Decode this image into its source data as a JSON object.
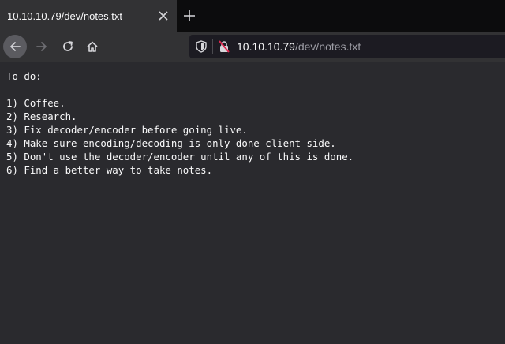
{
  "tab": {
    "title": "10.10.10.79/dev/notes.txt",
    "close_icon": "close-icon",
    "new_tab_icon": "plus-icon"
  },
  "nav": {
    "back_icon": "arrow-left-icon",
    "forward_icon": "arrow-right-icon",
    "reload_icon": "reload-icon",
    "home_icon": "home-icon"
  },
  "url": {
    "host": "10.10.10.79",
    "path": "/dev/notes.txt",
    "shield_icon": "shield-icon",
    "insecure_icon": "insecure-lock-icon"
  },
  "document": {
    "lines": [
      "To do:",
      "",
      "1) Coffee.",
      "2) Research.",
      "3) Fix decoder/encoder before going live.",
      "4) Make sure encoding/decoding is only done client-side.",
      "5) Don't use the decoder/encoder until any of this is done.",
      "6) Find a better way to take notes."
    ]
  },
  "colors": {
    "background": "#2a2a2e",
    "text": "#f9f9fa",
    "chrome": "#323234",
    "insecure_accent": "#e22850"
  }
}
